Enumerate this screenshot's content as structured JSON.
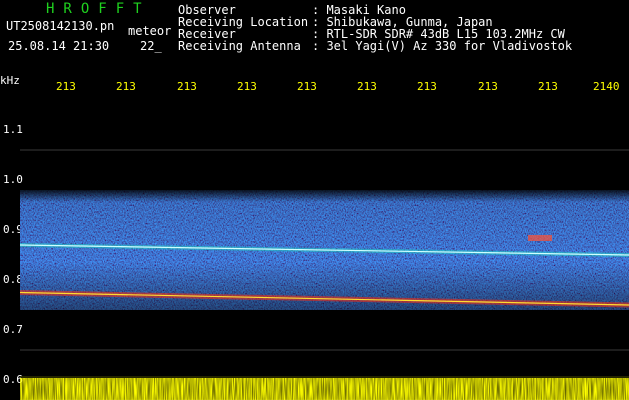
{
  "header": {
    "app_title": "HROFFT",
    "file_name": "UT2508142130.pn",
    "meteor_label": "meteor",
    "timestamp": "25.08.14 21:30",
    "time_tail": "22_"
  },
  "station_info": [
    {
      "key": "Observer",
      "value": ": Masaki Kano"
    },
    {
      "key": "Receiving Location",
      "value": ": Shibukawa, Gunma, Japan"
    },
    {
      "key": "Receiver",
      "value": ": RTL-SDR SDR# 43dB L15 103.2MHz CW"
    },
    {
      "key": "Receiving Antenna",
      "value": ": 3el Yagi(V) Az 330 for Vladivostok"
    }
  ],
  "axes": {
    "unit": "kHz",
    "time_ticks": [
      "213",
      "213",
      "213",
      "213",
      "213",
      "213",
      "213",
      "213",
      "213",
      "2140"
    ],
    "freq_ticks": [
      "1.1",
      "1.0",
      "0.9",
      "0.8",
      "0.7",
      "0.6"
    ]
  },
  "colors": {
    "background": "#000000",
    "title_green": "#1fd21f",
    "tick_yellow": "#ffff00",
    "signal_red": "#ff2020",
    "noise_blue": "#1838c8"
  },
  "chart_data": {
    "type": "heatmap",
    "xlabel": "",
    "ylabel": "kHz",
    "x_ticks": [
      "213",
      "213",
      "213",
      "213",
      "213",
      "213",
      "213",
      "213",
      "213",
      "2140"
    ],
    "y_ticks": [
      1.1,
      1.0,
      0.9,
      0.8,
      0.7,
      0.6
    ],
    "ylim": [
      0.6,
      1.2
    ],
    "noise_band_khz": [
      0.78,
      1.02
    ],
    "carriers": [
      {
        "start_khz": 0.91,
        "end_khz": 0.89
      },
      {
        "start_khz": 0.815,
        "end_khz": 0.79
      }
    ]
  }
}
